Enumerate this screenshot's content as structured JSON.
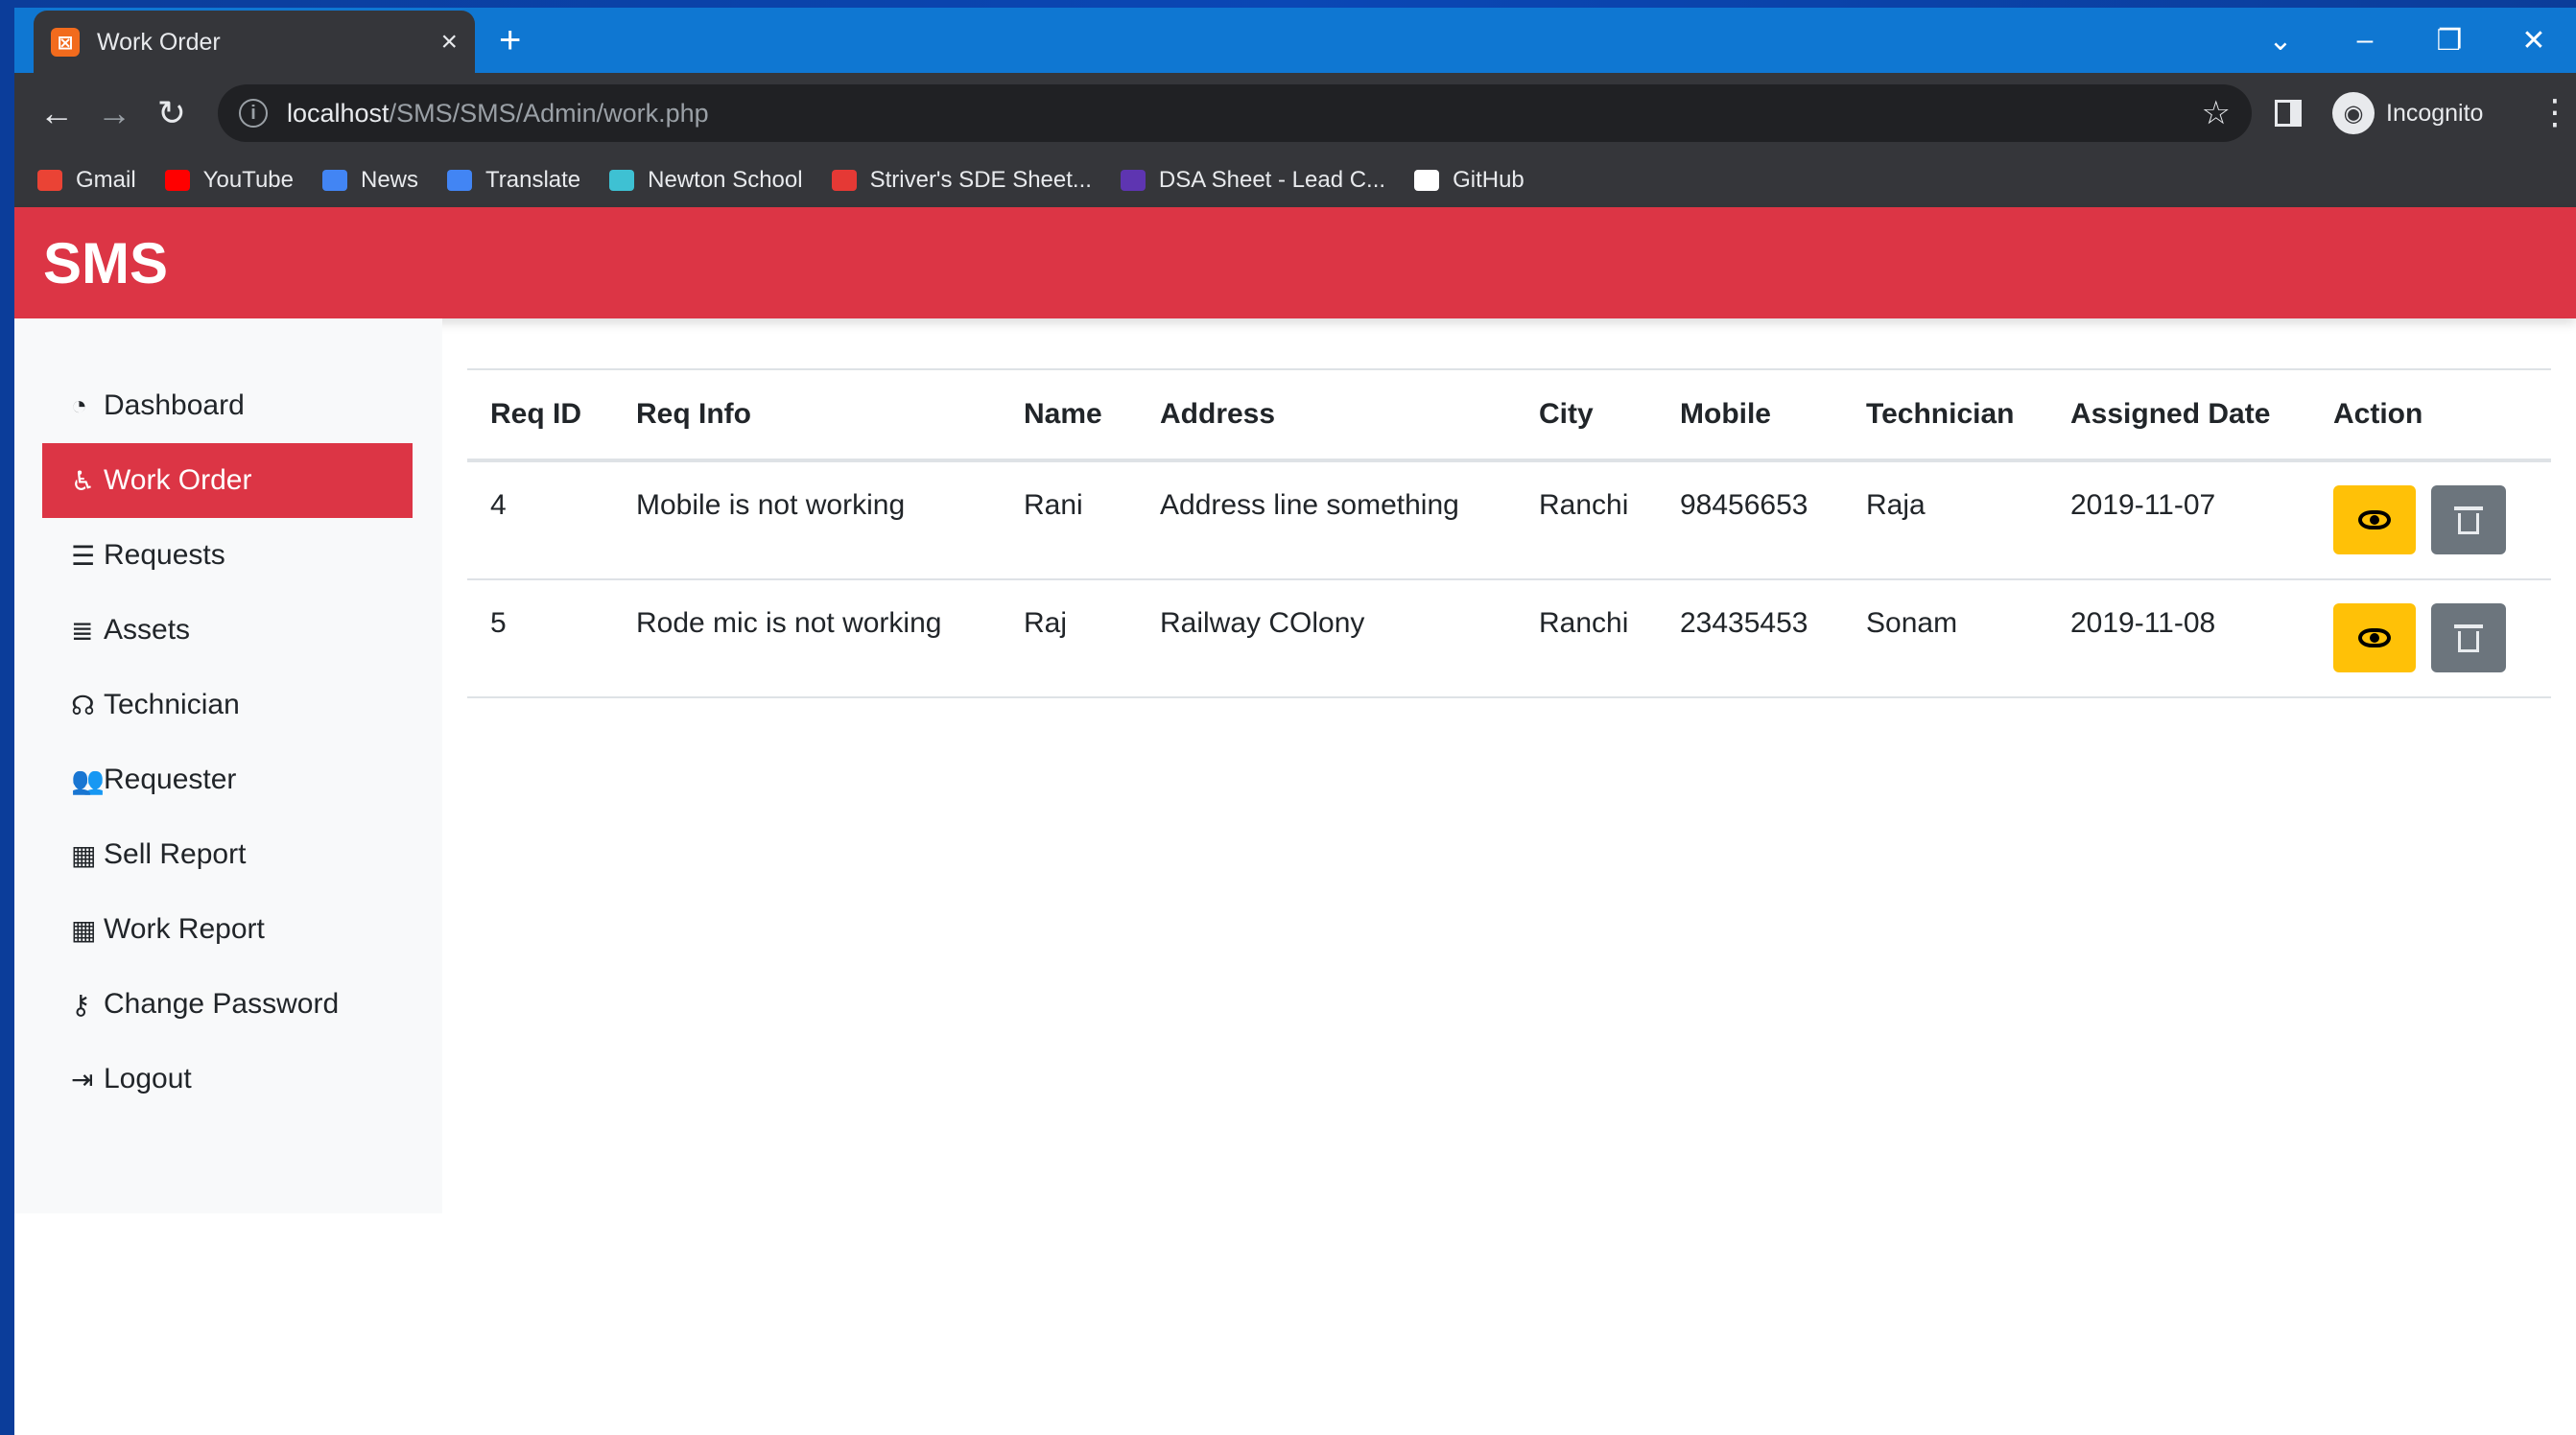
{
  "browser": {
    "tab_title": "Work Order",
    "tab_close": "×",
    "new_tab": "+",
    "url_host": "localhost",
    "url_path": "/SMS/SMS/Admin/work.php",
    "profile_label": "Incognito",
    "bookmarks": [
      {
        "label": "Gmail",
        "color": "#ea4335"
      },
      {
        "label": "YouTube",
        "color": "#ff0000"
      },
      {
        "label": "News",
        "color": "#4285f4"
      },
      {
        "label": "Translate",
        "color": "#4285f4"
      },
      {
        "label": "Newton School",
        "color": "#3ec1d3"
      },
      {
        "label": "Striver's SDE Sheet...",
        "color": "#e53935"
      },
      {
        "label": "DSA Sheet - Lead C...",
        "color": "#5e35b1"
      },
      {
        "label": "GitHub",
        "color": "#ffffff"
      }
    ]
  },
  "app": {
    "brand": "SMS",
    "accent": "#dc3545",
    "sidebar": [
      {
        "label": "Dashboard",
        "icon": "dashboard-icon",
        "active": false
      },
      {
        "label": "Work Order",
        "icon": "accessible-icon",
        "active": true
      },
      {
        "label": "Requests",
        "icon": "align-center-icon",
        "active": false
      },
      {
        "label": "Assets",
        "icon": "database-icon",
        "active": false
      },
      {
        "label": "Technician",
        "icon": "headset-icon",
        "active": false
      },
      {
        "label": "Requester",
        "icon": "users-icon",
        "active": false
      },
      {
        "label": "Sell Report",
        "icon": "table-icon",
        "active": false
      },
      {
        "label": "Work Report",
        "icon": "table-icon",
        "active": false
      },
      {
        "label": "Change Password",
        "icon": "key-icon",
        "active": false
      },
      {
        "label": "Logout",
        "icon": "sign-out-icon",
        "active": false
      }
    ]
  },
  "table": {
    "headers": [
      "Req ID",
      "Req Info",
      "Name",
      "Address",
      "City",
      "Mobile",
      "Technician",
      "Assigned Date",
      "Action"
    ],
    "rows": [
      [
        "4",
        "Mobile is not working",
        "Rani",
        "Address line something",
        "Ranchi",
        "98456653",
        "Raja",
        "2019-11-07"
      ],
      [
        "5",
        "Rode mic is not working",
        "Raj",
        "Railway COlony",
        "Ranchi",
        "23435453",
        "Sonam",
        "2019-11-08"
      ]
    ]
  }
}
